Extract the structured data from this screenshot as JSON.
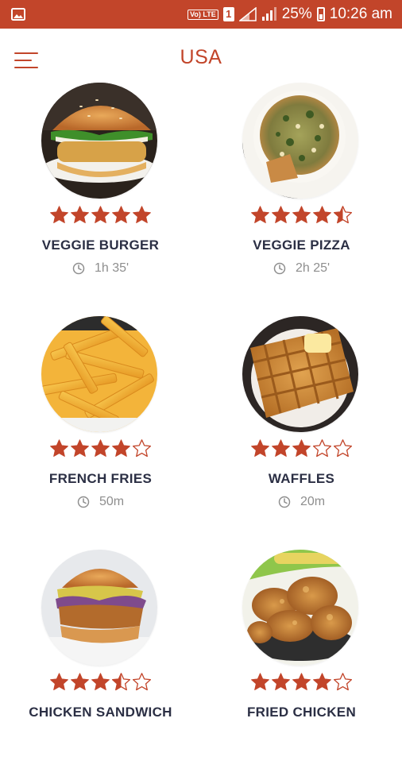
{
  "status_bar": {
    "volte": "Vo) LTE",
    "sim": "1",
    "battery_percent": "25%",
    "time": "10:26 am",
    "icons": [
      "gallery-icon",
      "volte-icon",
      "sim-icon",
      "signal-icon",
      "battery-icon"
    ]
  },
  "header": {
    "title": "USA",
    "menu_icon": "hamburger-menu-icon"
  },
  "colors": {
    "accent": "#c2452a",
    "star": "#c2452a",
    "title_text": "#2b2f44",
    "muted": "#8e8e8e"
  },
  "recipes": [
    {
      "name": "VEGGIE BURGER",
      "time": "1h 35'",
      "rating": 5,
      "image": "veggie-burger-photo"
    },
    {
      "name": "VEGGIE PIZZA",
      "time": "2h 25'",
      "rating": 4.5,
      "image": "veggie-pizza-photo"
    },
    {
      "name": "FRENCH FRIES",
      "time": "50m",
      "rating": 4,
      "image": "french-fries-photo"
    },
    {
      "name": "WAFFLES",
      "time": "20m",
      "rating": 3,
      "image": "waffles-photo"
    },
    {
      "name": "CHICKEN SANDWICH",
      "time": "",
      "rating": 3.5,
      "image": "chicken-sandwich-photo"
    },
    {
      "name": "FRIED CHICKEN",
      "time": "",
      "rating": 4,
      "image": "fried-chicken-photo"
    }
  ]
}
